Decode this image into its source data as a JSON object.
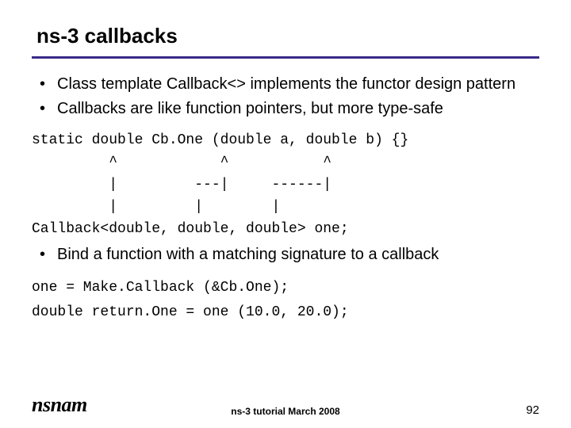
{
  "title": "ns-3 callbacks",
  "bullets1": [
    "Class template Callback<> implements the functor design pattern",
    "Callbacks are like function pointers, but more type-safe"
  ],
  "code1": "static double Cb.One (double a, double b) {}\n         ^            ^           ^\n         |         ---|     ------|\n         |         |        |\nCallback<double, double, double> one;",
  "bullets2": [
    "Bind a function with a matching signature to a callback"
  ],
  "code2": "one = Make.Callback (&Cb.One);\ndouble return.One = one (10.0, 20.0);",
  "footer": {
    "logo": "nsnam",
    "center": "ns-3 tutorial March 2008",
    "page": "92"
  }
}
